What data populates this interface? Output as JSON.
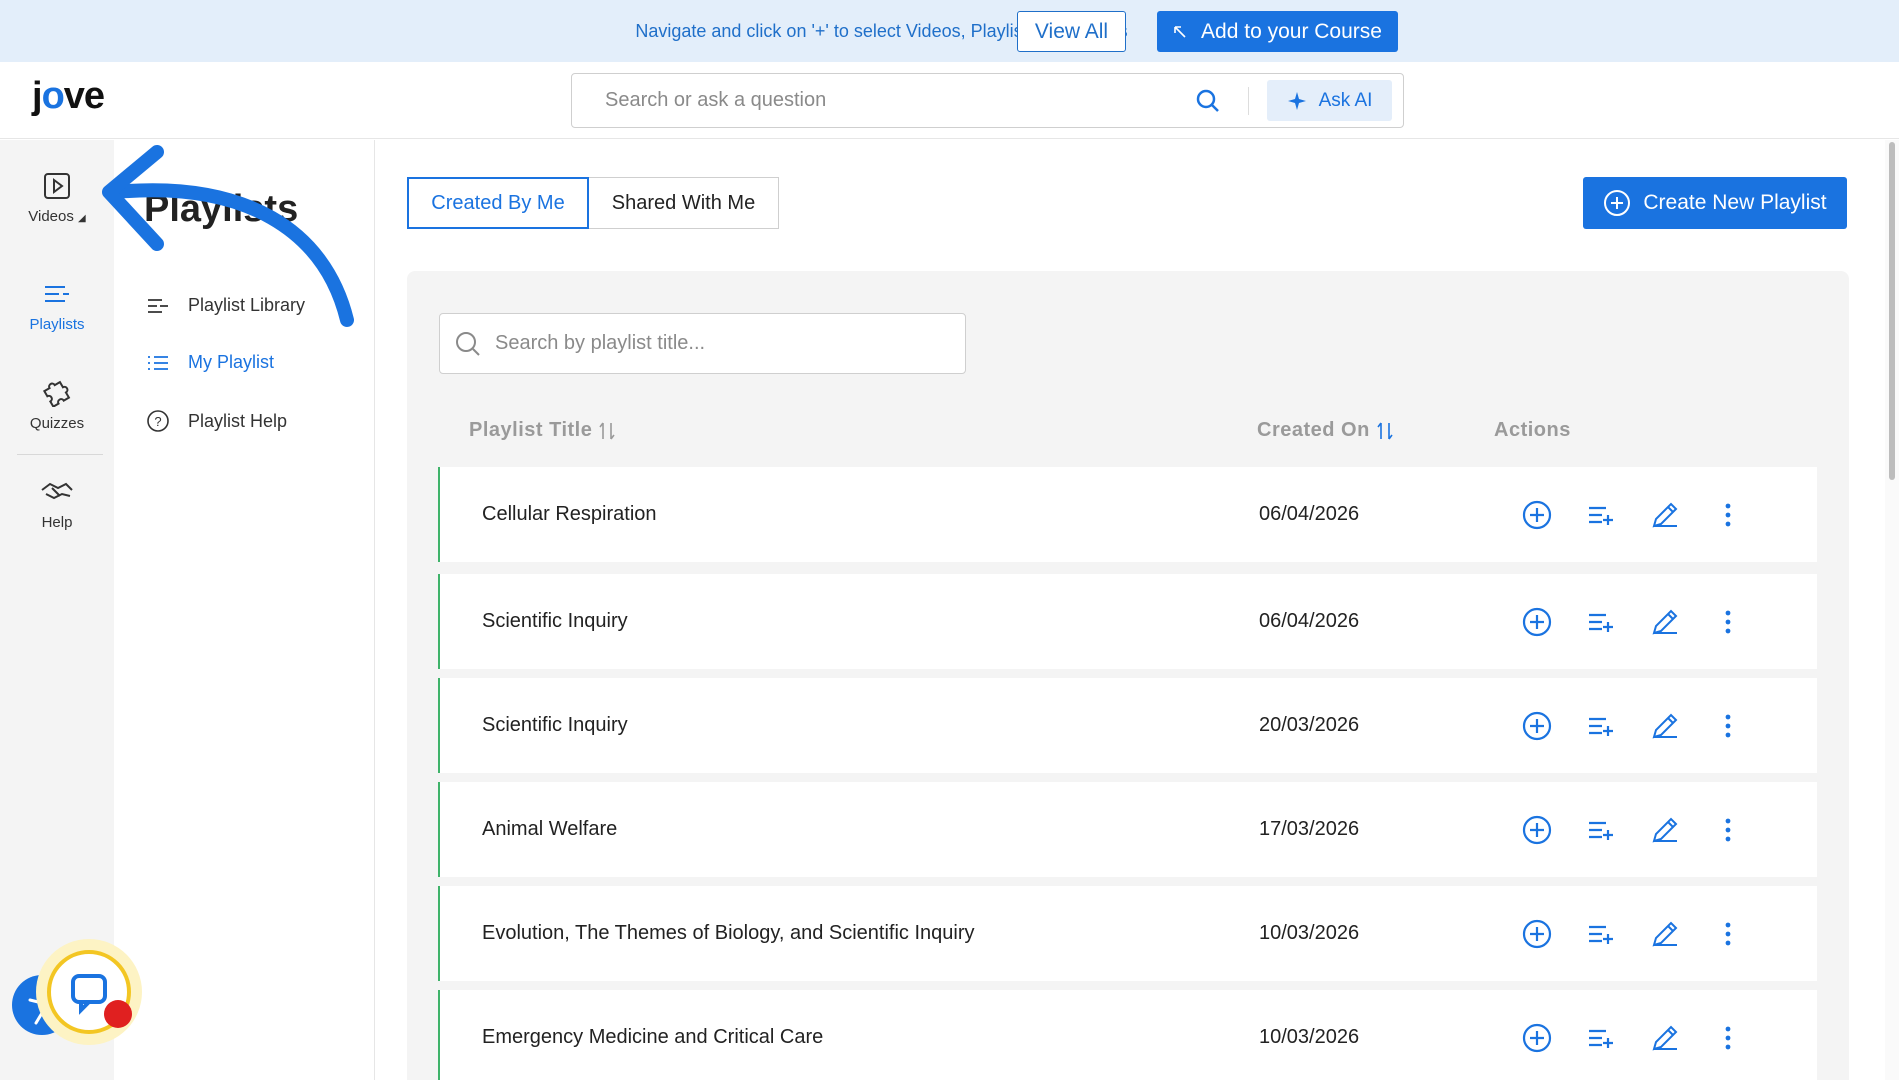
{
  "banner": {
    "text": "Navigate and click on '+' to select Videos, Playlists or Quizzes",
    "view_all": "View All",
    "add_to_course": "Add to your Course"
  },
  "header": {
    "logo": "jove",
    "search_placeholder": "Search or ask a question",
    "ask_ai": "Ask AI"
  },
  "rail": {
    "items": [
      {
        "label": "Videos",
        "icon": "play-square-icon"
      },
      {
        "label": "Playlists",
        "icon": "playlist-icon"
      },
      {
        "label": "Quizzes",
        "icon": "puzzle-icon"
      },
      {
        "label": "Help",
        "icon": "handshake-icon"
      }
    ]
  },
  "subsidebar": {
    "title": "Playlists",
    "items": [
      {
        "label": "Playlist Library"
      },
      {
        "label": "My Playlist"
      },
      {
        "label": "Playlist Help"
      }
    ]
  },
  "main": {
    "tabs": [
      {
        "label": "Created By Me"
      },
      {
        "label": "Shared With Me"
      }
    ],
    "create_button": "Create New Playlist",
    "search_placeholder": "Search by playlist title...",
    "columns": {
      "title": "Playlist Title",
      "created": "Created On",
      "actions": "Actions"
    },
    "rows": [
      {
        "title": "Cellular Respiration",
        "date": "06/04/2026"
      },
      {
        "title": "Scientific Inquiry",
        "date": "06/04/2026"
      },
      {
        "title": "Scientific Inquiry",
        "date": "20/03/2026"
      },
      {
        "title": "Animal Welfare",
        "date": "17/03/2026"
      },
      {
        "title": "Evolution, The Themes of Biology, and Scientific Inquiry",
        "date": "10/03/2026"
      },
      {
        "title": "Emergency Medicine and Critical Care",
        "date": "10/03/2026"
      }
    ]
  },
  "colors": {
    "accent": "#1a73e0",
    "banner_bg": "#e3eefa",
    "row_accent": "#3fb36a",
    "panel_bg": "#f4f4f4"
  }
}
